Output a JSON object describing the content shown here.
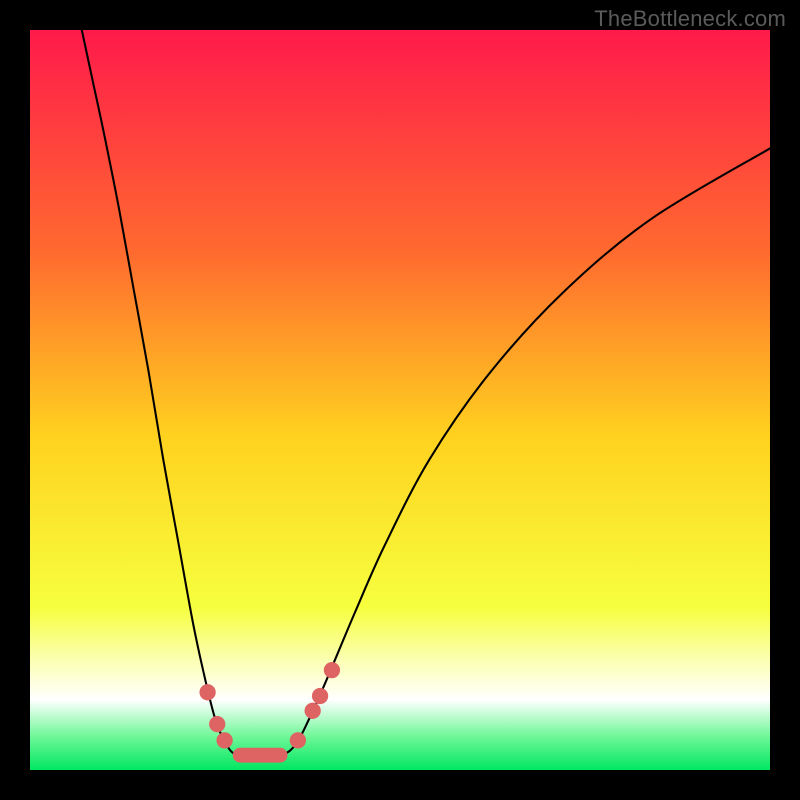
{
  "watermark": "TheBottleneck.com",
  "chart_data": {
    "type": "line",
    "title": "",
    "xlabel": "",
    "ylabel": "",
    "x_range": [
      0,
      100
    ],
    "y_range": [
      0,
      100
    ],
    "background_gradient": {
      "stops": [
        {
          "offset": 0,
          "color": "#ff1a4b"
        },
        {
          "offset": 0.3,
          "color": "#ff6a2f"
        },
        {
          "offset": 0.55,
          "color": "#ffd21f"
        },
        {
          "offset": 0.78,
          "color": "#f6ff3e"
        },
        {
          "offset": 0.85,
          "color": "#fbffb0"
        },
        {
          "offset": 0.905,
          "color": "#ffffff"
        },
        {
          "offset": 0.955,
          "color": "#6ef797"
        },
        {
          "offset": 1.0,
          "color": "#00e762"
        }
      ]
    },
    "series": [
      {
        "name": "left-curve",
        "color": "#000000",
        "points": [
          {
            "x": 7.0,
            "y": 100.0
          },
          {
            "x": 8.5,
            "y": 93.0
          },
          {
            "x": 10.0,
            "y": 86.0
          },
          {
            "x": 12.0,
            "y": 76.0
          },
          {
            "x": 14.0,
            "y": 65.0
          },
          {
            "x": 16.0,
            "y": 54.0
          },
          {
            "x": 18.0,
            "y": 42.0
          },
          {
            "x": 20.0,
            "y": 31.0
          },
          {
            "x": 22.0,
            "y": 20.0
          },
          {
            "x": 23.5,
            "y": 13.0
          },
          {
            "x": 25.0,
            "y": 7.0
          },
          {
            "x": 26.5,
            "y": 3.5
          },
          {
            "x": 28.0,
            "y": 2.0
          },
          {
            "x": 31.0,
            "y": 1.9
          },
          {
            "x": 34.0,
            "y": 2.0
          },
          {
            "x": 36.0,
            "y": 3.6
          },
          {
            "x": 38.0,
            "y": 7.5
          },
          {
            "x": 40.0,
            "y": 12.0
          },
          {
            "x": 44.0,
            "y": 21.5
          },
          {
            "x": 48.0,
            "y": 30.5
          },
          {
            "x": 54.0,
            "y": 42.0
          },
          {
            "x": 62.0,
            "y": 53.5
          },
          {
            "x": 72.0,
            "y": 64.5
          },
          {
            "x": 84.0,
            "y": 74.5
          },
          {
            "x": 100.0,
            "y": 84.0
          }
        ]
      }
    ],
    "markers": [
      {
        "x": 24.0,
        "y": 10.5,
        "r": 1.1,
        "color": "#de6464"
      },
      {
        "x": 25.3,
        "y": 6.2,
        "r": 1.1,
        "color": "#de6464"
      },
      {
        "x": 26.3,
        "y": 4.0,
        "r": 1.1,
        "color": "#de6464"
      },
      {
        "x": 36.2,
        "y": 4.0,
        "r": 1.1,
        "color": "#de6464"
      },
      {
        "x": 38.2,
        "y": 8.0,
        "r": 1.1,
        "color": "#de6464"
      },
      {
        "x": 39.2,
        "y": 10.0,
        "r": 1.1,
        "color": "#de6464"
      },
      {
        "x": 40.8,
        "y": 13.5,
        "r": 1.1,
        "color": "#de6464"
      }
    ],
    "bottom_bar": {
      "x_start": 27.4,
      "x_end": 34.8,
      "y": 2.0,
      "thickness": 2.0,
      "color": "#de6464"
    }
  }
}
